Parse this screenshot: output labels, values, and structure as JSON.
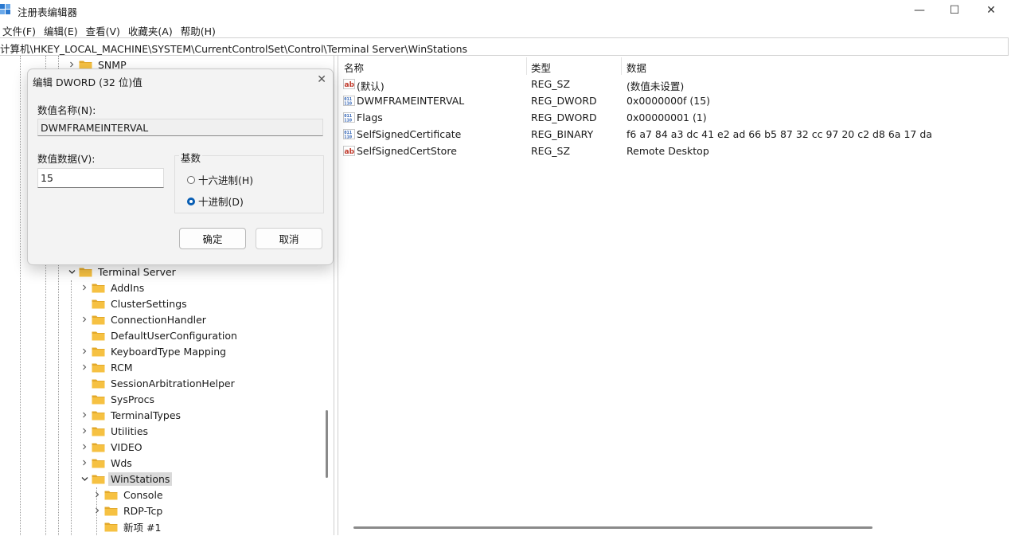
{
  "window": {
    "title": "注册表编辑器",
    "minimize_glyph": "—",
    "maximize_glyph": "☐",
    "close_glyph": "✕"
  },
  "menu": [
    "文件(F)",
    "编辑(E)",
    "查看(V)",
    "收藏夹(A)",
    "帮助(H)"
  ],
  "address": "计算机\\HKEY_LOCAL_MACHINE\\SYSTEM\\CurrentControlSet\\Control\\Terminal Server\\WinStations",
  "tree": {
    "items": [
      {
        "label": "SNMP",
        "expander": "collapsed"
      },
      {
        "label": "Terminal Server",
        "expander": "expanded"
      },
      {
        "label": "AddIns",
        "expander": "collapsed"
      },
      {
        "label": "ClusterSettings",
        "expander": "none"
      },
      {
        "label": "ConnectionHandler",
        "expander": "collapsed"
      },
      {
        "label": "DefaultUserConfiguration",
        "expander": "none"
      },
      {
        "label": "KeyboardType Mapping",
        "expander": "collapsed"
      },
      {
        "label": "RCM",
        "expander": "collapsed"
      },
      {
        "label": "SessionArbitrationHelper",
        "expander": "none"
      },
      {
        "label": "SysProcs",
        "expander": "none"
      },
      {
        "label": "TerminalTypes",
        "expander": "collapsed"
      },
      {
        "label": "Utilities",
        "expander": "collapsed"
      },
      {
        "label": "VIDEO",
        "expander": "collapsed"
      },
      {
        "label": "Wds",
        "expander": "collapsed"
      },
      {
        "label": "WinStations",
        "expander": "expanded",
        "selected": true
      },
      {
        "label": "Console",
        "expander": "collapsed"
      },
      {
        "label": "RDP-Tcp",
        "expander": "collapsed"
      },
      {
        "label": "新项 #1",
        "expander": "none"
      }
    ]
  },
  "list": {
    "headers": {
      "name": "名称",
      "type": "类型",
      "data": "数据"
    },
    "rows": [
      {
        "name": "(默认)",
        "type": "REG_SZ",
        "data": "(数值未设置)",
        "icon": "string-value-icon"
      },
      {
        "name": "DWMFRAMEINTERVAL",
        "type": "REG_DWORD",
        "data": "0x0000000f (15)",
        "icon": "binary-value-icon"
      },
      {
        "name": "Flags",
        "type": "REG_DWORD",
        "data": "0x00000001 (1)",
        "icon": "binary-value-icon"
      },
      {
        "name": "SelfSignedCertificate",
        "type": "REG_BINARY",
        "data": "f6 a7 84 a3 dc 41 e2 ad 66 b5 87 32 cc 97 20 c2 d8 6a 17 da",
        "icon": "binary-value-icon"
      },
      {
        "name": "SelfSignedCertStore",
        "type": "REG_SZ",
        "data": "Remote Desktop",
        "icon": "string-value-icon"
      }
    ]
  },
  "dialog": {
    "title": "编辑 DWORD (32 位)值",
    "close_glyph": "✕",
    "name_label": "数值名称(N):",
    "name_value": "DWMFRAMEINTERVAL",
    "data_label": "数值数据(V):",
    "data_value": "15",
    "base_label": "基数",
    "radio_hex": "十六进制(H)",
    "radio_dec": "十进制(D)",
    "base_selected": "decimal",
    "ok": "确定",
    "cancel": "取消"
  },
  "colors": {
    "accent": "#0a5fb4",
    "folder": "#f6c142",
    "folder_dark": "#e3a92a",
    "selection": "#d9d9d9",
    "string_icon": "#c0392b",
    "binary_icon": "#2b5fb4"
  }
}
